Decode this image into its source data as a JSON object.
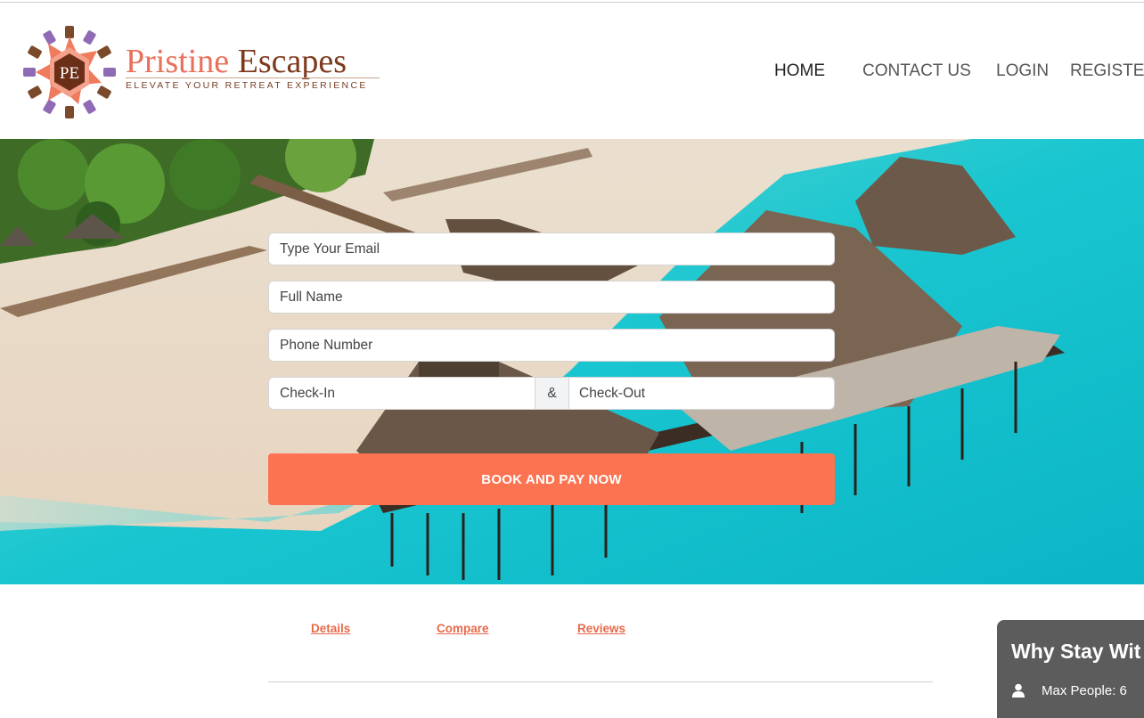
{
  "brand": {
    "monogram": "PE",
    "name_part1": "Pristine",
    "name_part2": "Escapes",
    "tagline": "ELEVATE YOUR RETREAT EXPERIENCE"
  },
  "nav": {
    "items": [
      {
        "label": "HOME",
        "active": true
      },
      {
        "label": "CONTACT US",
        "active": false
      },
      {
        "label": "LOGIN",
        "active": false
      },
      {
        "label": "REGISTER",
        "active": false
      }
    ]
  },
  "booking_form": {
    "email_placeholder": "Type Your Email",
    "name_placeholder": "Full Name",
    "phone_placeholder": "Phone Number",
    "checkin_placeholder": "Check-In",
    "separator": "&",
    "checkout_placeholder": "Check-Out",
    "submit_label": "BOOK AND PAY NOW"
  },
  "tabs": [
    {
      "label": "Details"
    },
    {
      "label": "Compare"
    },
    {
      "label": "Reviews"
    }
  ],
  "why_card": {
    "title": "Why Stay Wit",
    "max_people": "Max People: 6"
  },
  "colors": {
    "accent": "#fb7351",
    "link": "#e8694a",
    "brand_orange": "#e9705a",
    "brand_brown": "#7d3a1d",
    "card_bg": "#5c5c5c"
  },
  "icons": {
    "logo": "pe-mandala-logo",
    "person": "user-icon"
  }
}
